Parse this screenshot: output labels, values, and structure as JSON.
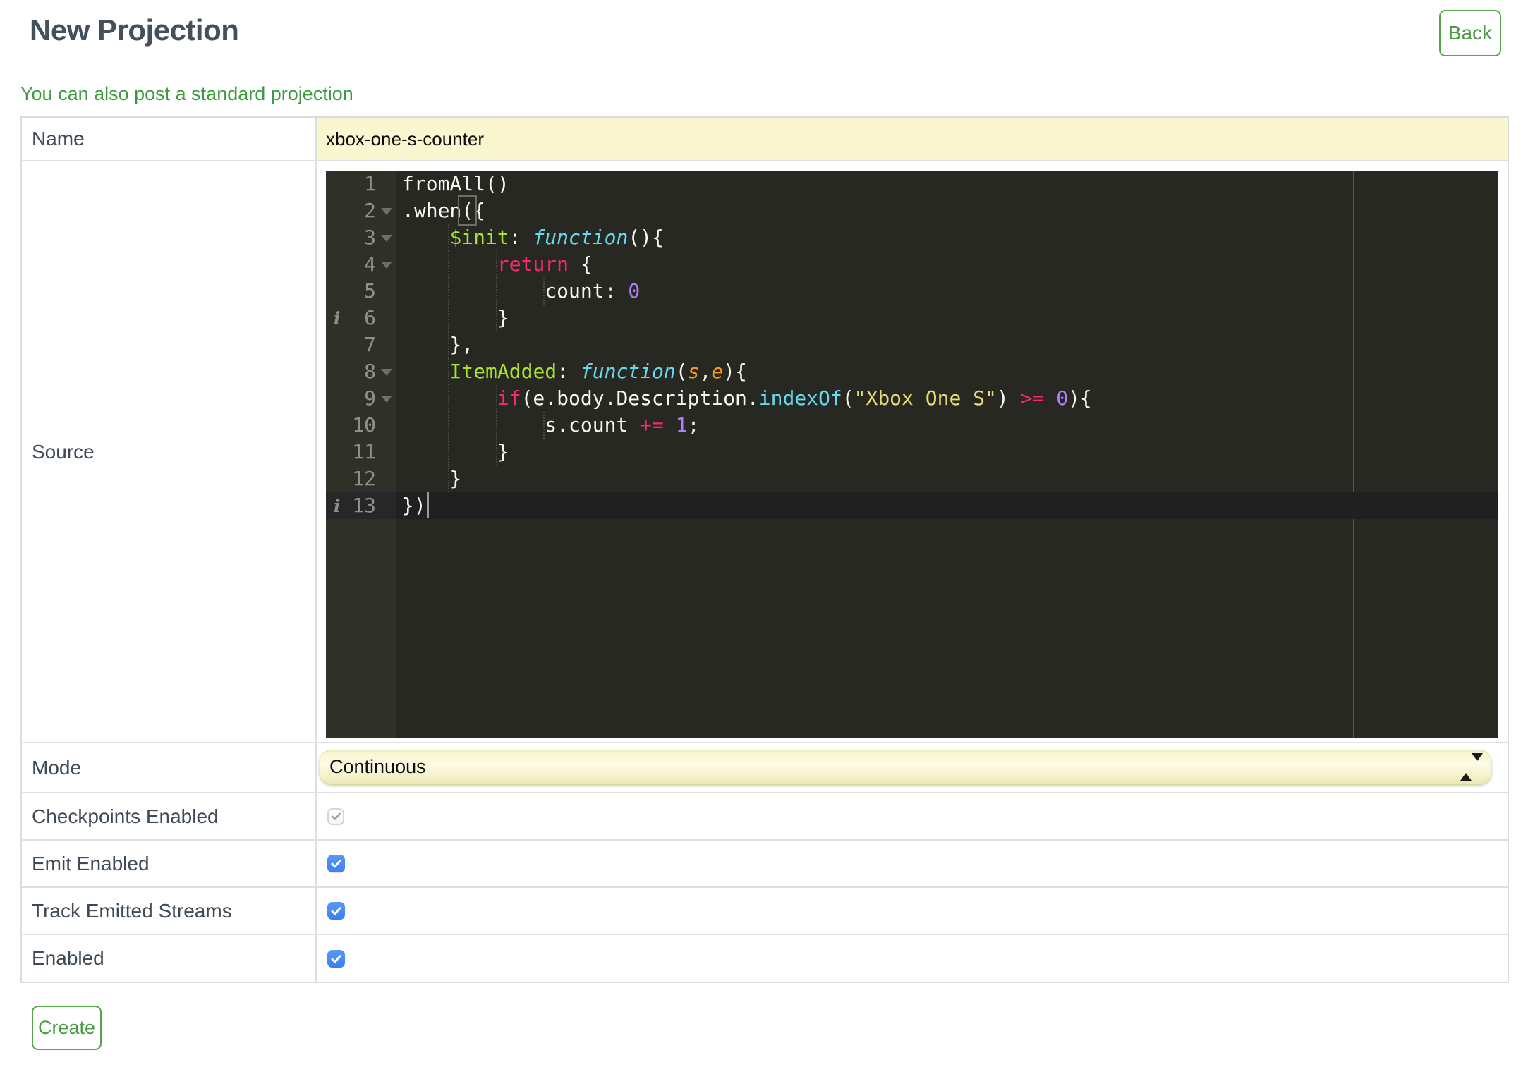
{
  "page": {
    "title": "New Projection",
    "back_label": "Back",
    "link_text": "You can also post a standard projection",
    "create_label": "Create"
  },
  "form": {
    "name": {
      "label": "Name",
      "value": "xbox-one-s-counter"
    },
    "source": {
      "label": "Source"
    },
    "mode": {
      "label": "Mode",
      "value": "Continuous"
    },
    "checkpoints_enabled": {
      "label": "Checkpoints Enabled",
      "checked": true,
      "disabled": true
    },
    "emit_enabled": {
      "label": "Emit Enabled",
      "checked": true
    },
    "track_emitted_streams": {
      "label": "Track Emitted Streams",
      "checked": true
    },
    "enabled": {
      "label": "Enabled",
      "checked": true
    }
  },
  "editor": {
    "language": "javascript",
    "line_count": 13,
    "lines": [
      {
        "num": 1,
        "indent": 0,
        "segs": [
          [
            "p",
            "fromAll()"
          ]
        ]
      },
      {
        "num": 2,
        "indent": 0,
        "fold": true,
        "segs": [
          [
            "p",
            ".when"
          ],
          [
            "bm",
            "("
          ],
          [
            "p",
            "{"
          ]
        ]
      },
      {
        "num": 3,
        "indent": 4,
        "fold": true,
        "segs": [
          [
            "g",
            "$init"
          ],
          [
            "p",
            ": "
          ],
          [
            "ci",
            "function"
          ],
          [
            "p",
            "(){"
          ]
        ]
      },
      {
        "num": 4,
        "indent": 8,
        "fold": true,
        "segs": [
          [
            "k",
            "return"
          ],
          [
            "p",
            " {"
          ]
        ]
      },
      {
        "num": 5,
        "indent": 12,
        "segs": [
          [
            "p",
            "count: "
          ],
          [
            "n",
            "0"
          ]
        ]
      },
      {
        "num": 6,
        "indent": 8,
        "info": true,
        "segs": [
          [
            "p",
            "}"
          ]
        ]
      },
      {
        "num": 7,
        "indent": 4,
        "segs": [
          [
            "p",
            "},"
          ]
        ]
      },
      {
        "num": 8,
        "indent": 4,
        "fold": true,
        "segs": [
          [
            "g",
            "ItemAdded"
          ],
          [
            "p",
            ": "
          ],
          [
            "ci",
            "function"
          ],
          [
            "p",
            "("
          ],
          [
            "oi",
            "s"
          ],
          [
            "p",
            ","
          ],
          [
            "oi",
            "e"
          ],
          [
            "p",
            "){"
          ]
        ]
      },
      {
        "num": 9,
        "indent": 8,
        "fold": true,
        "segs": [
          [
            "k",
            "if"
          ],
          [
            "p",
            "(e.body.Description."
          ],
          [
            "c",
            "indexOf"
          ],
          [
            "p",
            "("
          ],
          [
            "s",
            "\"Xbox One S\""
          ],
          [
            "p",
            ") "
          ],
          [
            "k",
            ">="
          ],
          [
            "p",
            " "
          ],
          [
            "n",
            "0"
          ],
          [
            "p",
            "){"
          ]
        ]
      },
      {
        "num": 10,
        "indent": 12,
        "segs": [
          [
            "p",
            "s.count "
          ],
          [
            "k",
            "+="
          ],
          [
            "p",
            " "
          ],
          [
            "n",
            "1"
          ],
          [
            "p",
            ";"
          ]
        ]
      },
      {
        "num": 11,
        "indent": 8,
        "segs": [
          [
            "p",
            "}"
          ]
        ]
      },
      {
        "num": 12,
        "indent": 4,
        "segs": [
          [
            "p",
            "}"
          ]
        ]
      },
      {
        "num": 13,
        "indent": 0,
        "info": true,
        "active": true,
        "cursor": true,
        "segs": [
          [
            "p",
            "})"
          ]
        ]
      }
    ]
  },
  "colors": {
    "accent_green": "#57a44c",
    "link_green": "#3e9a40",
    "heading_slate": "#44505b",
    "name_field_bg": "#faf6d0",
    "mode_select_bg": "#f7f2c8",
    "checkbox_blue": "#4285f4",
    "editor_bg": "#272822",
    "editor_gutter_bg": "#2f3129",
    "editor_active_line": "#202020",
    "token_keyword": "#f92672",
    "token_entity": "#a6e22e",
    "token_support": "#66d9ef",
    "token_string": "#e6db74",
    "token_number": "#ae81ff",
    "token_param": "#fd971f"
  }
}
